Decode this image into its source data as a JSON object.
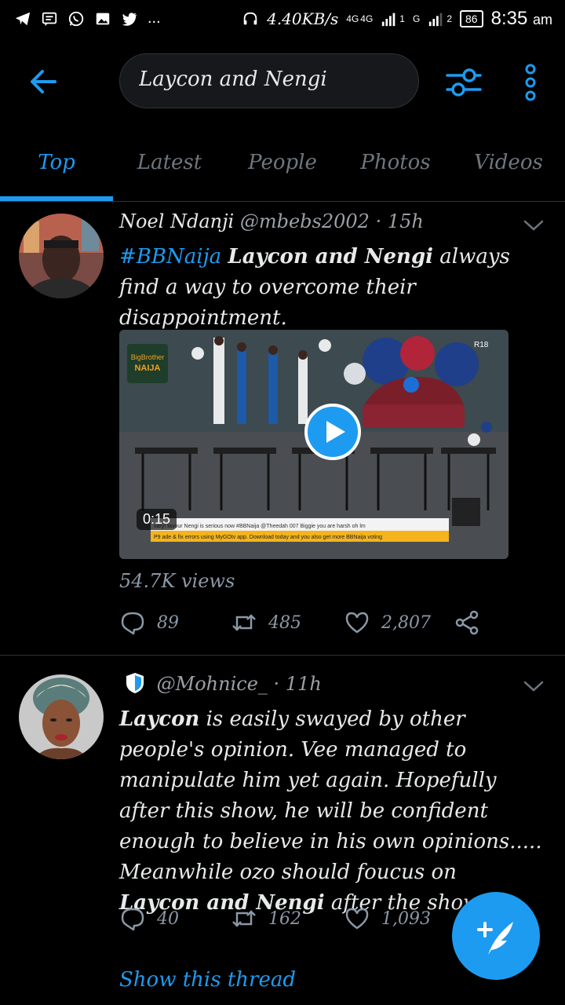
{
  "status_bar": {
    "net_speed": "4.40KB/s",
    "net_1": "4G",
    "net_2": "4G",
    "sim1": "1",
    "sim2": "2",
    "g_label": "G",
    "battery": "86",
    "time": "8:35",
    "ampm": "am",
    "dots": "..."
  },
  "search": {
    "query": "Laycon and Nengi"
  },
  "tabs": [
    {
      "label": "Top"
    },
    {
      "label": "Latest"
    },
    {
      "label": "People"
    },
    {
      "label": "Photos"
    },
    {
      "label": "Videos"
    }
  ],
  "tweets": [
    {
      "name": "Noel Ndanji",
      "handle": "@mbebs2002",
      "time": "· 15h",
      "tag": "#BBNaija",
      "bold": "Laycon and Nengi",
      "text_rest": "always find a way to overcome their disappointment.",
      "video": {
        "duration": "0:15",
        "brand_1": "BigBrother",
        "brand_2": "NAIJA",
        "rating": "R18",
        "ticker_1": "vary! favour Nengi is serious now #BBNaija  @Theedah 007 Biggie you are harsh oh lm",
        "ticker_2": "P9 ade & fix errors using MyGOtv app. Download today and you also get more BBNaija voting"
      },
      "views": "54.7K views",
      "replies": "89",
      "retweets": "485",
      "likes": "2,807"
    },
    {
      "handle": "@Mohnice_",
      "time": "· 11h",
      "bold_1": "Laycon",
      "text_1": "is easily swayed by other people's opinion. Vee managed to manipulate him yet again. Hopefully after this show, he will be confident enough to believe in his own opinions..... Meanwhile ozo should foucus on",
      "bold_2": "Laycon and Nengi",
      "text_2": "after the show",
      "replies": "40",
      "retweets": "162",
      "likes": "1,093",
      "thread_link": "Show this thread"
    }
  ],
  "colors": {
    "accent": "#1d9bf0",
    "background": "#000000",
    "divider": "#2f3336"
  },
  "icons": [
    "back-arrow-icon",
    "filter-sliders-icon",
    "more-vertical-icon",
    "reply-icon",
    "retweet-icon",
    "like-icon",
    "share-icon",
    "compose-icon",
    "play-icon",
    "verified-shield-icon"
  ]
}
